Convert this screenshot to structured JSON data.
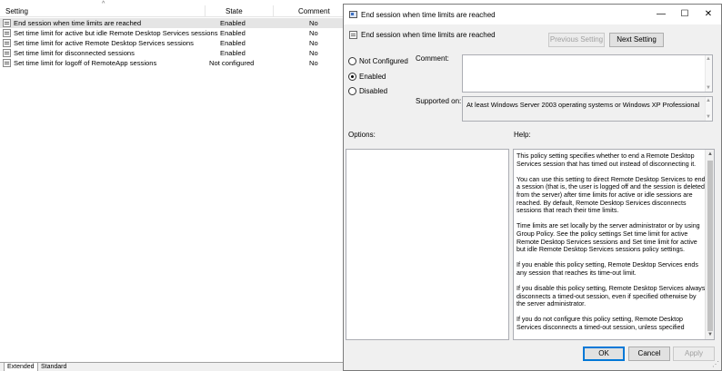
{
  "list": {
    "sort_caret": "^",
    "columns": {
      "setting": "Setting",
      "state": "State",
      "comment": "Comment"
    },
    "rows": [
      {
        "setting": "End session when time limits are reached",
        "state": "Enabled",
        "comment": "No"
      },
      {
        "setting": "Set time limit for active but idle Remote Desktop Services sessions",
        "state": "Enabled",
        "comment": "No"
      },
      {
        "setting": "Set time limit for active Remote Desktop Services sessions",
        "state": "Enabled",
        "comment": "No"
      },
      {
        "setting": "Set time limit for disconnected sessions",
        "state": "Enabled",
        "comment": "No"
      },
      {
        "setting": "Set time limit for logoff of RemoteApp sessions",
        "state": "Not configured",
        "comment": "No"
      }
    ],
    "tabs": [
      "Extended",
      "Standard"
    ]
  },
  "dialog": {
    "window_title": "End session when time limits are reached",
    "heading": "End session when time limits are reached",
    "buttons": {
      "previous": "Previous Setting",
      "next": "Next Setting",
      "ok": "OK",
      "cancel": "Cancel",
      "apply": "Apply"
    },
    "window_controls": {
      "minimize": "—",
      "maximize": "☐",
      "close": "✕"
    },
    "radios": [
      {
        "label": "Not Configured",
        "checked": false
      },
      {
        "label": "Enabled",
        "checked": true
      },
      {
        "label": "Disabled",
        "checked": false
      }
    ],
    "labels": {
      "comment": "Comment:",
      "supported_on": "Supported on:",
      "options": "Options:",
      "help": "Help:"
    },
    "supported_value": "At least Windows Server 2003 operating systems or Windows XP Professional",
    "help_paragraphs": [
      "This policy setting specifies whether to end a Remote Desktop Services session that has timed out instead of disconnecting it.",
      "You can use this setting to direct Remote Desktop Services to end a session (that is, the user is logged off and the session is deleted from the server) after time limits for active or idle sessions are reached. By default, Remote Desktop Services disconnects sessions that reach their time limits.",
      "Time limits are set locally by the server administrator or by using Group Policy. See the policy settings Set time limit for active Remote Desktop Services sessions and Set time limit for active but idle Remote Desktop Services sessions policy settings.",
      "If you enable this policy setting, Remote Desktop Services ends any session that reaches its time-out limit.",
      "If you disable this policy setting, Remote Desktop Services always disconnects a timed-out session, even if specified otherwise by the server administrator.",
      "If you do not configure this policy setting, Remote Desktop Services disconnects a timed-out session, unless specified"
    ]
  },
  "icons": {
    "policy": "policy-setting-icon",
    "window": "group-policy-window-icon"
  },
  "colors": {
    "selected_row": "#e5e5e5",
    "dialog_bg": "#f0f0f0",
    "default_button_border": "#0078d7"
  }
}
